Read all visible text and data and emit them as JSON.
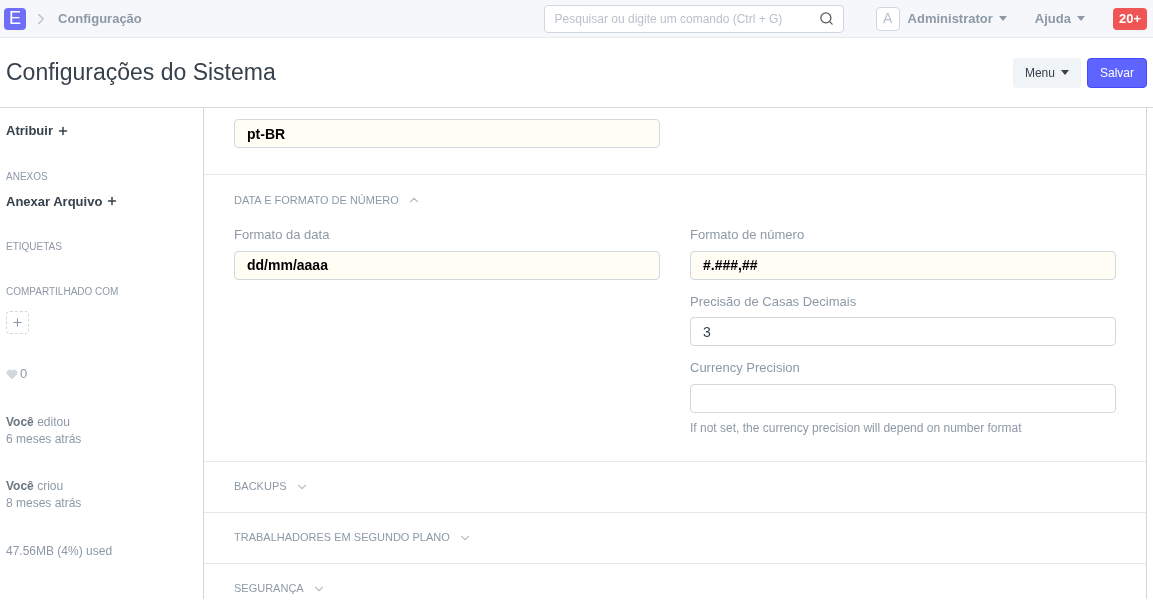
{
  "navbar": {
    "logo": "E",
    "breadcrumb": "Configuração",
    "search": {
      "placeholder": "Pesquisar ou digite um comando (Ctrl + G)"
    },
    "avatar": "A",
    "user": "Administrator",
    "help": "Ajuda",
    "notifications": "20+"
  },
  "page": {
    "title": "Configurações do Sistema",
    "buttons": [
      {
        "label": "Menu",
        "kind": "dropdown"
      },
      {
        "label": "Salvar",
        "kind": "primary"
      }
    ]
  },
  "sidebar": {
    "assign": "Atribuir",
    "attachments_heading": "ANEXOS",
    "attach": "Anexar Arquivo",
    "tags_heading": "ETIQUETAS",
    "shared_heading": "COMPARTILHADO COM",
    "likes": "0",
    "activity": [
      {
        "text": "**Você** editou",
        "time": "6 meses atrás"
      },
      {
        "text": "**Você** criou",
        "time": "8 meses atrás"
      }
    ],
    "usage": "47.56MB (4%) used"
  },
  "top_field": {
    "value": "pt-BR",
    "highlighted": true
  },
  "sections": [
    {
      "title": "DATA E FORMATO DE NÚMERO",
      "expanded": true,
      "columns": [
        [
          {
            "label": "Formato da data",
            "value": "dd/mm/aaaa",
            "highlighted": true
          }
        ],
        [
          {
            "label": "Formato de número",
            "value": "#.###,##",
            "highlighted": true
          },
          {
            "label": "Precisão de Casas Decimais",
            "value": "3",
            "highlighted": false
          },
          {
            "label": "Currency Precision",
            "highlighted": false,
            "help": "If not set, the currency precision will depend on number format"
          }
        ]
      ]
    },
    {
      "title": "BACKUPS",
      "expanded": false
    },
    {
      "title": "TRABALHADORES EM SEGUNDO PLANO",
      "expanded": false
    },
    {
      "title": "SEGURANÇA",
      "expanded": false
    }
  ]
}
